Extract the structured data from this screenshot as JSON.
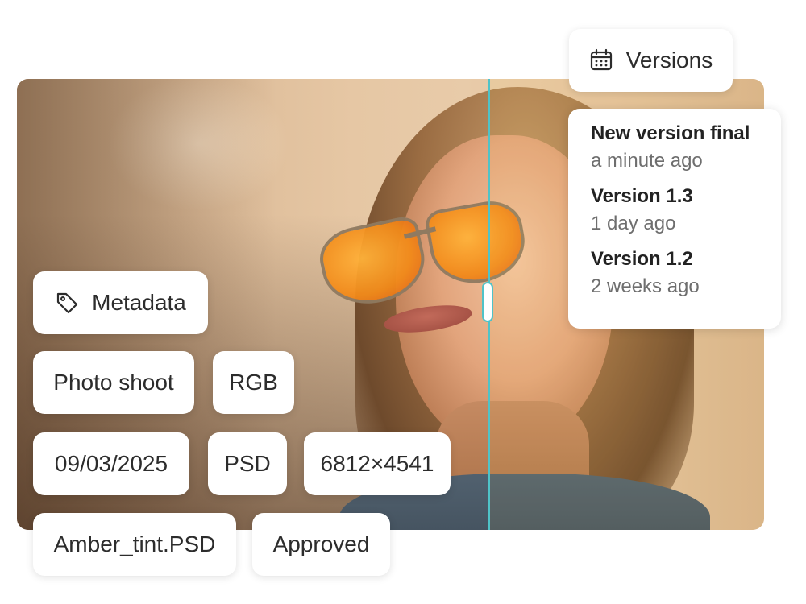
{
  "versions": {
    "button_label": "Versions",
    "items": [
      {
        "name": "New version final",
        "time": "a minute ago"
      },
      {
        "name": "Version 1.3",
        "time": "1 day ago"
      },
      {
        "name": "Version 1.2",
        "time": "2 weeks ago"
      }
    ]
  },
  "metadata": {
    "button_label": "Metadata",
    "chips": {
      "category": "Photo shoot",
      "color_mode": "RGB",
      "date": "09/03/2025",
      "format": "PSD",
      "dimensions": "6812×4541",
      "filename": "Amber_tint.PSD",
      "status": "Approved"
    }
  },
  "compare": {
    "divider_color": "#4fc3c8"
  }
}
